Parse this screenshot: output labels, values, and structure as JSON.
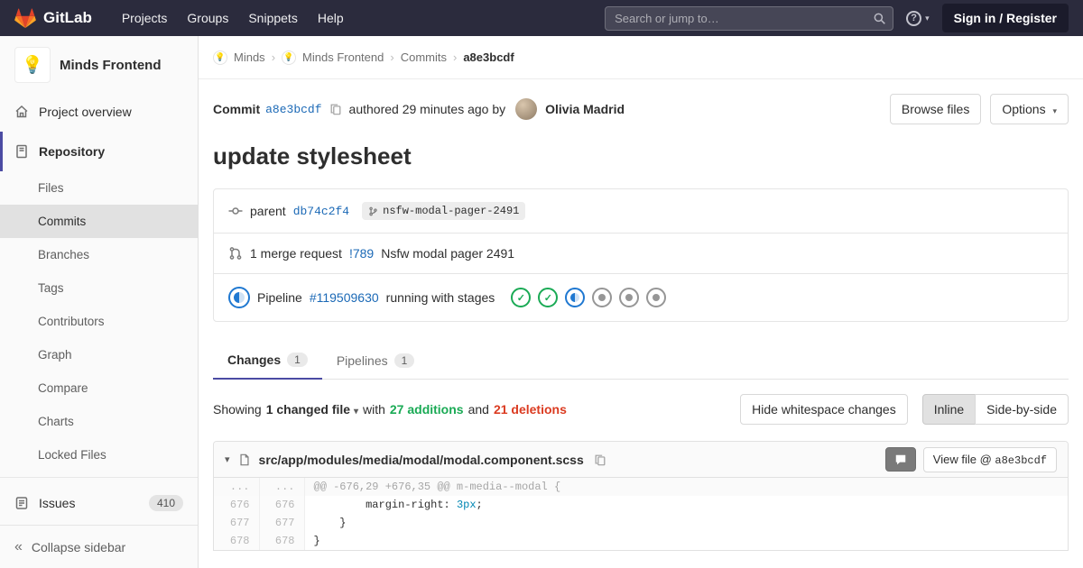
{
  "colors": {
    "accent": "#1b69b6",
    "green": "#1aaa55",
    "red": "#db3b21",
    "navbar": "#2b2b3d",
    "theme_indigo": "#4b4ba3",
    "running_blue": "#1f78d1"
  },
  "glyphs": {
    "caret": "▾",
    "chevron": "›",
    "collapse": "«",
    "check": "✓",
    "ellipsis": "...",
    "help": "?"
  },
  "navbar": {
    "brand": "GitLab",
    "menu": [
      "Projects",
      "Groups",
      "Snippets",
      "Help"
    ],
    "search_placeholder": "Search or jump to…",
    "sign_in_label": "Sign in / Register"
  },
  "sidebar": {
    "project_name": "Minds Frontend",
    "avatar_glyph": "💡",
    "overview_label": "Project overview",
    "repository_label": "Repository",
    "repo_items": [
      "Files",
      "Commits",
      "Branches",
      "Tags",
      "Contributors",
      "Graph",
      "Compare",
      "Charts",
      "Locked Files"
    ],
    "issues_label": "Issues",
    "issues_count": "410",
    "collapse_label": "Collapse sidebar"
  },
  "breadcrumb": {
    "items": [
      "Minds",
      "Minds Frontend",
      "Commits",
      "a8e3bcdf"
    ],
    "group_avatar_glyph": "💡",
    "project_avatar_glyph": "💡"
  },
  "commit": {
    "label": "Commit",
    "sha": "a8e3bcdf",
    "authored_text": "authored 29 minutes ago by",
    "author": "Olivia Madrid",
    "title": "update stylesheet",
    "browse_files_label": "Browse files",
    "options_label": "Options",
    "parent_label": "parent",
    "parent_sha": "db74c2f4",
    "branch_name": "nsfw-modal-pager-2491",
    "mr_count_text": "1 merge request",
    "mr_ref": "!789",
    "mr_title": "Nsfw modal pager 2491",
    "pipeline_label": "Pipeline",
    "pipeline_id": "#119509630",
    "pipeline_status_text": "running with stages",
    "pipeline_stages": [
      "success",
      "success",
      "running",
      "created",
      "created",
      "created"
    ]
  },
  "tabs": {
    "changes_label": "Changes",
    "changes_count": "1",
    "pipelines_label": "Pipelines",
    "pipelines_count": "1"
  },
  "summary": {
    "showing": "Showing",
    "changed_files": "1 changed file",
    "with": "with",
    "additions": "27 additions",
    "and": "and",
    "deletions": "21 deletions",
    "hide_whitespace_label": "Hide whitespace changes",
    "inline_label": "Inline",
    "side_by_side_label": "Side-by-side"
  },
  "diff": {
    "file_path": "src/app/modules/media/modal/modal.component.scss",
    "view_file_label": "View file @",
    "view_file_sha": "a8e3bcdf",
    "hunk_header": "@@ -676,29 +676,35 @@ m-media--modal {",
    "lines": [
      {
        "old": "676",
        "new": "676",
        "pre": "        margin-right: ",
        "val": "3px",
        "post": ";"
      },
      {
        "old": "677",
        "new": "677",
        "pre": "    }",
        "val": "",
        "post": ""
      },
      {
        "old": "678",
        "new": "678",
        "pre": "}",
        "val": "",
        "post": ""
      }
    ]
  }
}
